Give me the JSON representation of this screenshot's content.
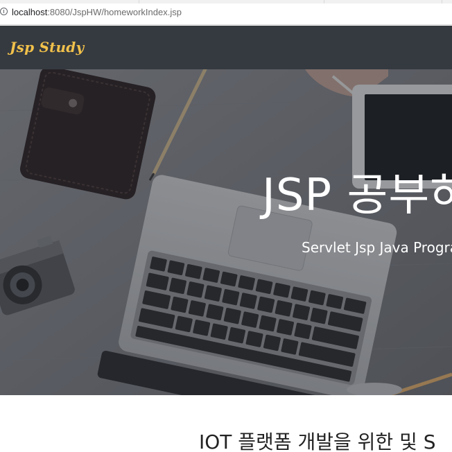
{
  "browser": {
    "url_host": "localhost",
    "url_path": ":8080/JspHW/homeworkIndex.jsp"
  },
  "navbar": {
    "brand": "Jsp Study",
    "brand_color": "#f2c14b",
    "background": "#353a40"
  },
  "hero": {
    "title": "JSP 공부하",
    "subtitle": "Servlet Jsp Java Program"
  },
  "section": {
    "heading": "IOT 플랫폼 개발을 위한 및 S"
  },
  "icons": [
    "info-icon"
  ]
}
